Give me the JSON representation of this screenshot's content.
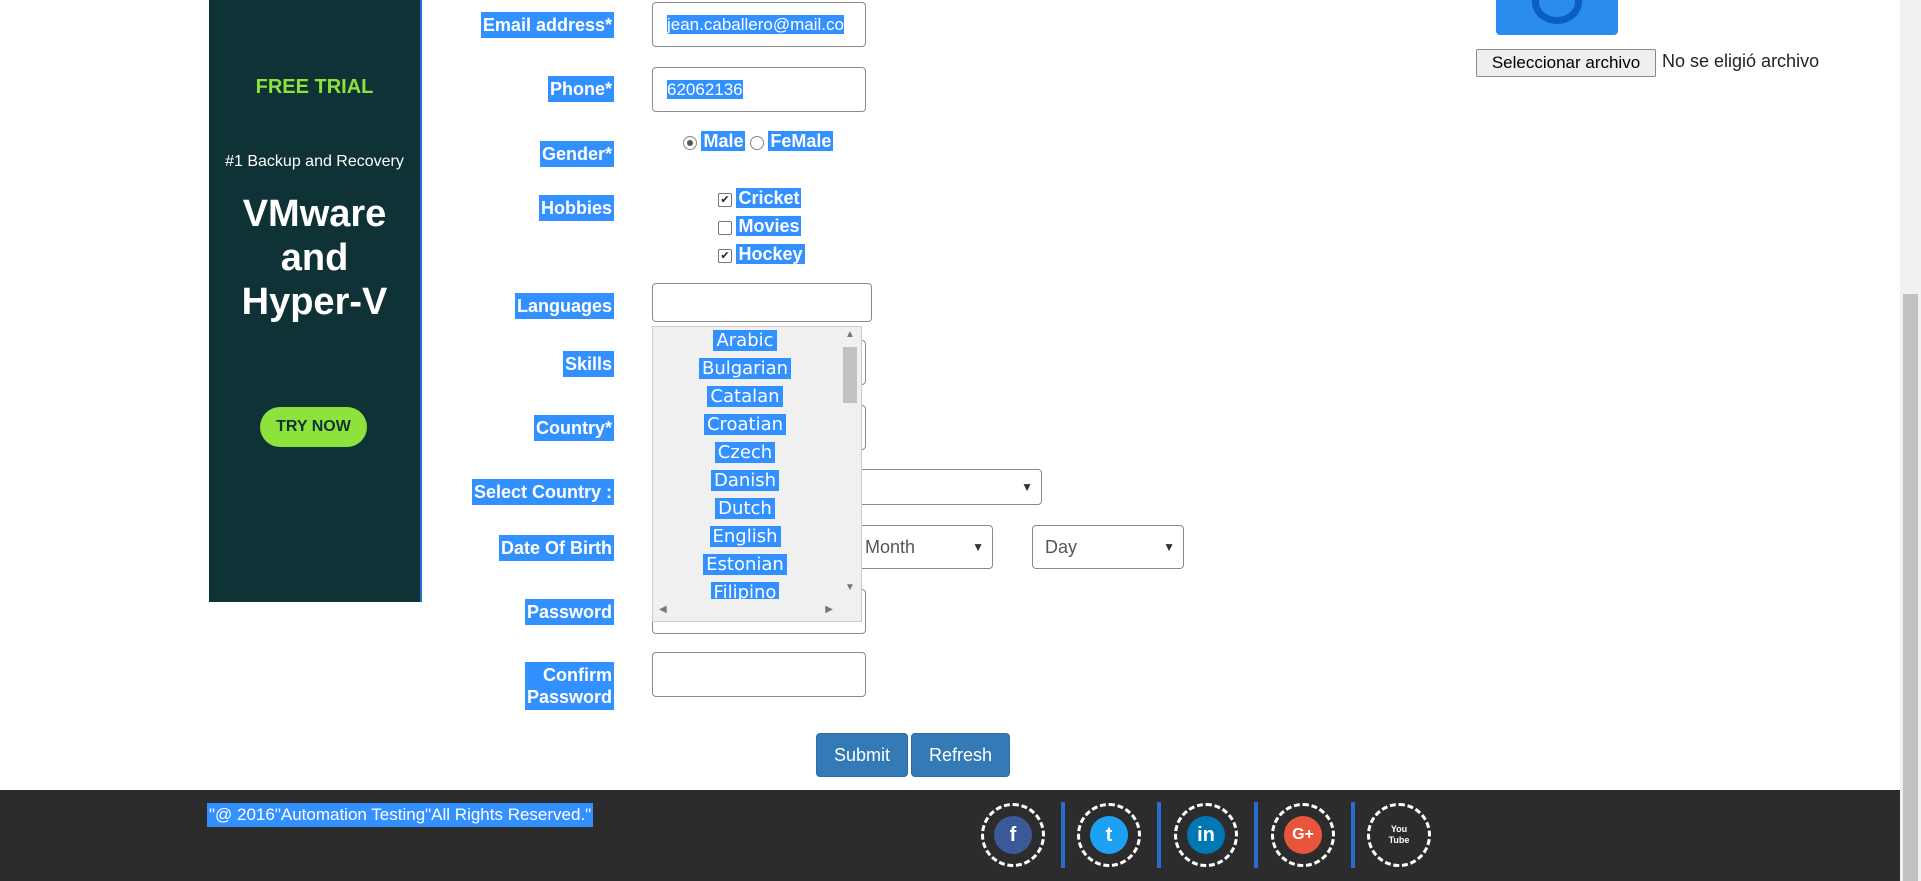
{
  "ad": {
    "free_trial": "FREE TRIAL",
    "tagline": "#1 Backup and Recovery",
    "title_line1": "VMware",
    "title_line2": "and",
    "title_line3": "Hyper-V",
    "cta": "TRY NOW"
  },
  "form": {
    "email_label": "Email address*",
    "email_value": "jean.caballero@mail.co",
    "phone_label": "Phone*",
    "phone_value": "62062136",
    "gender_label": "Gender*",
    "gender_male": "Male",
    "gender_female": "FeMale",
    "hobbies_label": "Hobbies",
    "hobby_cricket": "Cricket",
    "hobby_movies": "Movies",
    "hobby_hockey": "Hockey",
    "languages_label": "Languages",
    "skills_label": "Skills",
    "country_label": "Country*",
    "select_country_label": "Select Country :",
    "dob_label": "Date Of Birth",
    "month_placeholder": "Month",
    "day_placeholder": "Day",
    "password_label": "Password",
    "confirm_label_1": "Confirm",
    "confirm_label_2": "Password",
    "submit": "Submit",
    "refresh": "Refresh"
  },
  "languages": [
    "Arabic",
    "Bulgarian",
    "Catalan",
    "Croatian",
    "Czech",
    "Danish",
    "Dutch",
    "English",
    "Estonian",
    "Filipino"
  ],
  "upload": {
    "button": "Seleccionar archivo",
    "status": "No se eligió archivo"
  },
  "footer": {
    "copyright": "\"@ 2016\"Automation Testing\"All Rights Reserved.\""
  },
  "social": {
    "facebook": "f",
    "twitter": "t",
    "linkedin": "in",
    "googleplus": "G+",
    "youtube": "You Tube"
  },
  "colors": {
    "selection": "#3390ff",
    "ad_bg": "#0f3237",
    "ad_accent": "#8de23c",
    "button": "#337ab7",
    "footer_bg": "#2c2c2c"
  }
}
